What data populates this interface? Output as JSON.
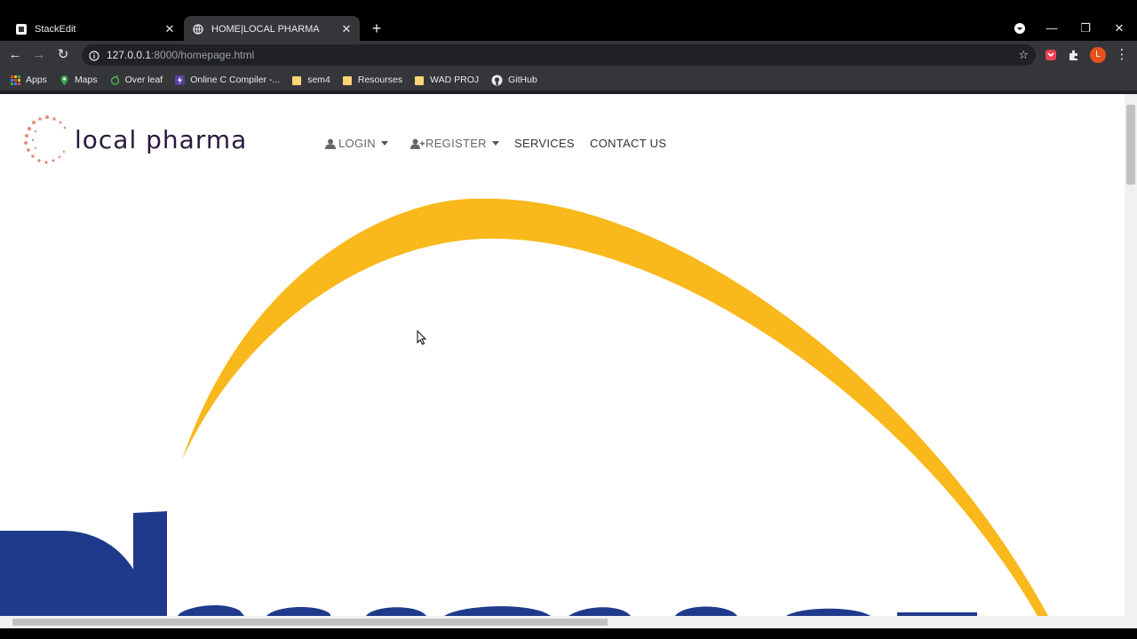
{
  "browser": {
    "tabs": [
      {
        "title": "StackEdit",
        "active": false
      },
      {
        "title": "HOME|LOCAL PHARMA",
        "active": true
      }
    ],
    "url_host": "127.0.0.1",
    "url_path": ":8000/homepage.html",
    "bookmarks": [
      {
        "label": "Apps",
        "icon": "apps-grid-icon"
      },
      {
        "label": "Maps",
        "icon": "maps-pin-icon"
      },
      {
        "label": "Over leaf",
        "icon": "overleaf-icon"
      },
      {
        "label": "Online C Compiler -...",
        "icon": "compiler-icon"
      },
      {
        "label": "sem4",
        "icon": "folder-icon"
      },
      {
        "label": "Resourses",
        "icon": "folder-icon"
      },
      {
        "label": "WAD PROJ",
        "icon": "folder-icon"
      },
      {
        "label": "GitHub",
        "icon": "github-icon"
      }
    ],
    "avatar_letter": "L"
  },
  "site": {
    "logo_text": "local pharma",
    "nav": {
      "login": "LOGIN",
      "register": "REGISTER",
      "services": "SERVICES",
      "contact": "CONTACT US"
    }
  },
  "colors": {
    "arc": "#f9b81b",
    "hero_text": "#1f3a8a",
    "logo_dots": "#e58b7d"
  }
}
